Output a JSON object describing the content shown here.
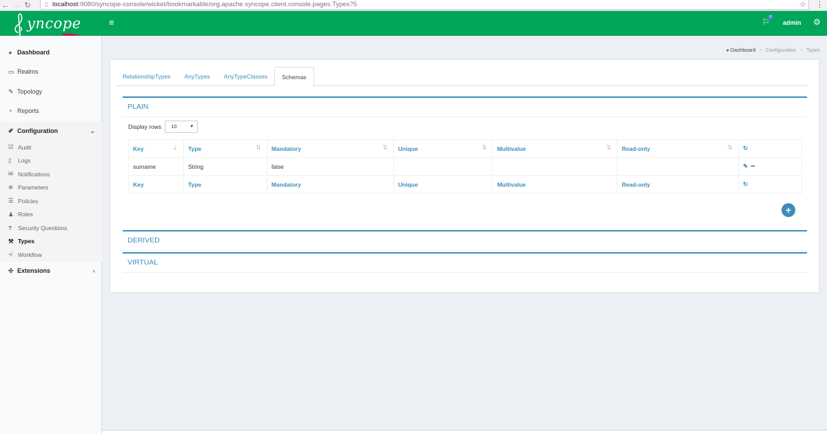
{
  "browser": {
    "url_host": "localhost",
    "url_rest": ":9080/syncope-console/wicket/bookmarkable/org.apache.syncope.client.console.pages.Types?5"
  },
  "header": {
    "logo_text": "yncope",
    "notification_count": "0",
    "user": "admin"
  },
  "sidebar": {
    "items": [
      {
        "label": "Dashboard",
        "icon": "dashboard-icon"
      },
      {
        "label": "Realms",
        "icon": "folder-icon"
      },
      {
        "label": "Topology",
        "icon": "plug-icon"
      },
      {
        "label": "Reports",
        "icon": "pie-chart-icon"
      },
      {
        "label": "Configuration",
        "icon": "edit-icon"
      },
      {
        "label": "Extensions",
        "icon": "puzzle-icon"
      }
    ],
    "sub_items": [
      {
        "label": "Audit",
        "icon": "check-square-icon"
      },
      {
        "label": "Logs",
        "icon": "file-icon"
      },
      {
        "label": "Notifications",
        "icon": "envelope-icon"
      },
      {
        "label": "Parameters",
        "icon": "cog-icon"
      },
      {
        "label": "Policies",
        "icon": "list-icon"
      },
      {
        "label": "Roles",
        "icon": "users-icon"
      },
      {
        "label": "Security Questions",
        "icon": "question-icon"
      },
      {
        "label": "Types",
        "icon": "wrench-icon"
      },
      {
        "label": "Workflow",
        "icon": "share-icon"
      }
    ]
  },
  "breadcrumb": [
    "Dashboard",
    "Configuration",
    "Types"
  ],
  "tabs": [
    "RelationshipTypes",
    "AnyTypes",
    "AnyTypeClasses",
    "Schemas"
  ],
  "sections": {
    "plain": "PLAIN",
    "derived": "DERIVED",
    "virtual": "VIRTUAL"
  },
  "display_rows": {
    "label": "Display rows",
    "value": "10"
  },
  "table": {
    "columns": [
      "Key",
      "Type",
      "Mandatory",
      "Unique",
      "Multivalue",
      "Read-only"
    ],
    "rows": [
      {
        "key": "surname",
        "type": "String",
        "mandatory": "false",
        "unique": "",
        "multivalue": "",
        "readonly": ""
      }
    ]
  }
}
